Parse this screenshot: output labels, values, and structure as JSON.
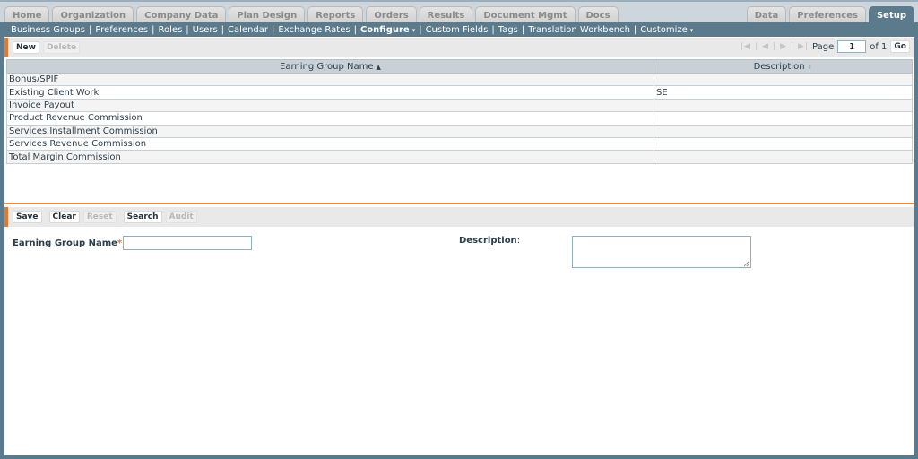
{
  "top_tabs_left": [
    "Home",
    "Organization",
    "Company Data",
    "Plan Design",
    "Reports",
    "Orders",
    "Results",
    "Document Mgmt",
    "Docs"
  ],
  "top_tabs_right": [
    "Data",
    "Preferences",
    "Setup"
  ],
  "active_tab": "Setup",
  "subnav": {
    "items": [
      "Business Groups",
      "Preferences",
      "Roles",
      "Users",
      "Calendar",
      "Exchange Rates",
      "Configure",
      "Custom Fields",
      "Tags",
      "Translation Workbench",
      "Customize"
    ],
    "separator": "|",
    "caret": "▾"
  },
  "list_toolbar": {
    "new_label": "New",
    "delete_label": "Delete"
  },
  "pager": {
    "first_icon": "first-page-icon",
    "prev_icon": "prev-page-icon",
    "next_icon": "next-page-icon",
    "last_icon": "last-page-icon",
    "page_label": "Page",
    "current_page": "1",
    "of_label": "of 1",
    "go_label": "Go"
  },
  "table": {
    "columns": [
      {
        "label": "Earning Group Name",
        "sort": "▲"
      },
      {
        "label": "Description",
        "sort": "⇕"
      }
    ],
    "rows": [
      {
        "name": "Bonus/SPIF",
        "description": ""
      },
      {
        "name": "Existing Client Work",
        "description": "SE"
      },
      {
        "name": "Invoice Payout",
        "description": ""
      },
      {
        "name": "Product Revenue Commission",
        "description": ""
      },
      {
        "name": "Services Installment Commission",
        "description": ""
      },
      {
        "name": "Services Revenue Commission",
        "description": ""
      },
      {
        "name": "Total Margin Commission",
        "description": ""
      }
    ]
  },
  "form_toolbar": {
    "save_label": "Save",
    "clear_label": "Clear",
    "reset_label": "Reset",
    "search_label": "Search",
    "audit_label": "Audit"
  },
  "form": {
    "name_label": "Earning Group Name",
    "required_mark": "*",
    "colon": ":",
    "name_value": "",
    "description_label": "Description",
    "description_value": ""
  },
  "colors": {
    "accent": "#e8772e",
    "header_bar": "#5b7a8c"
  }
}
